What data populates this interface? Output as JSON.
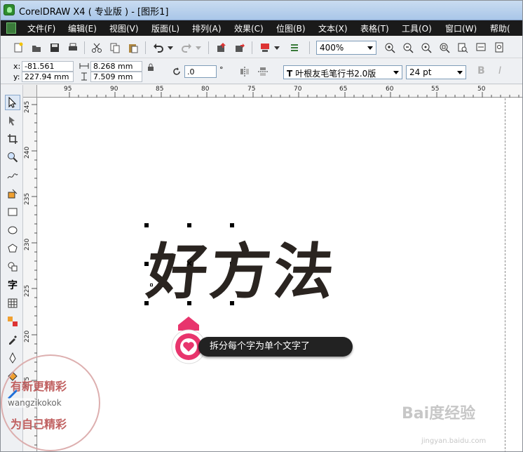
{
  "window": {
    "title": "CorelDRAW X4 ( 专业版 ) - [图形1]"
  },
  "menu": {
    "items": [
      "文件(F)",
      "编辑(E)",
      "视图(V)",
      "版面(L)",
      "排列(A)",
      "效果(C)",
      "位图(B)",
      "文本(X)",
      "表格(T)",
      "工具(O)",
      "窗口(W)",
      "帮助("
    ]
  },
  "toolbar": {
    "zoom_value": "400%"
  },
  "properties": {
    "x_label": "x:",
    "y_label": "y:",
    "x_value": "-81.561 mm",
    "y_value": "227.94 mm",
    "width_value": "8.268 mm",
    "height_value": "7.509 mm",
    "rotation_value": ".0",
    "rotation_unit": "°",
    "font_name": "叶根友毛笔行书2.0版",
    "font_size": "24 pt",
    "font_icon_label": "T",
    "bold_label": "B",
    "italic_label": "I"
  },
  "ruler": {
    "h_ticks": [
      "95",
      "90",
      "85",
      "80",
      "75",
      "70",
      "65",
      "60",
      "55",
      "50"
    ],
    "v_ticks": [
      "245",
      "240",
      "235",
      "230",
      "225",
      "220",
      "215"
    ]
  },
  "toolbox": {
    "text_tool_label": "字"
  },
  "canvas": {
    "text": "好方法",
    "center_mark": "×"
  },
  "callout": {
    "text": "拆分每个字为单个文字了"
  },
  "watermark": {
    "line1": "有新更精彩",
    "line2": "wangzikokok",
    "line3": "为自己精彩",
    "baidu_logo": "Bai度经验",
    "baidu_url": "jingyan.baidu.com"
  }
}
